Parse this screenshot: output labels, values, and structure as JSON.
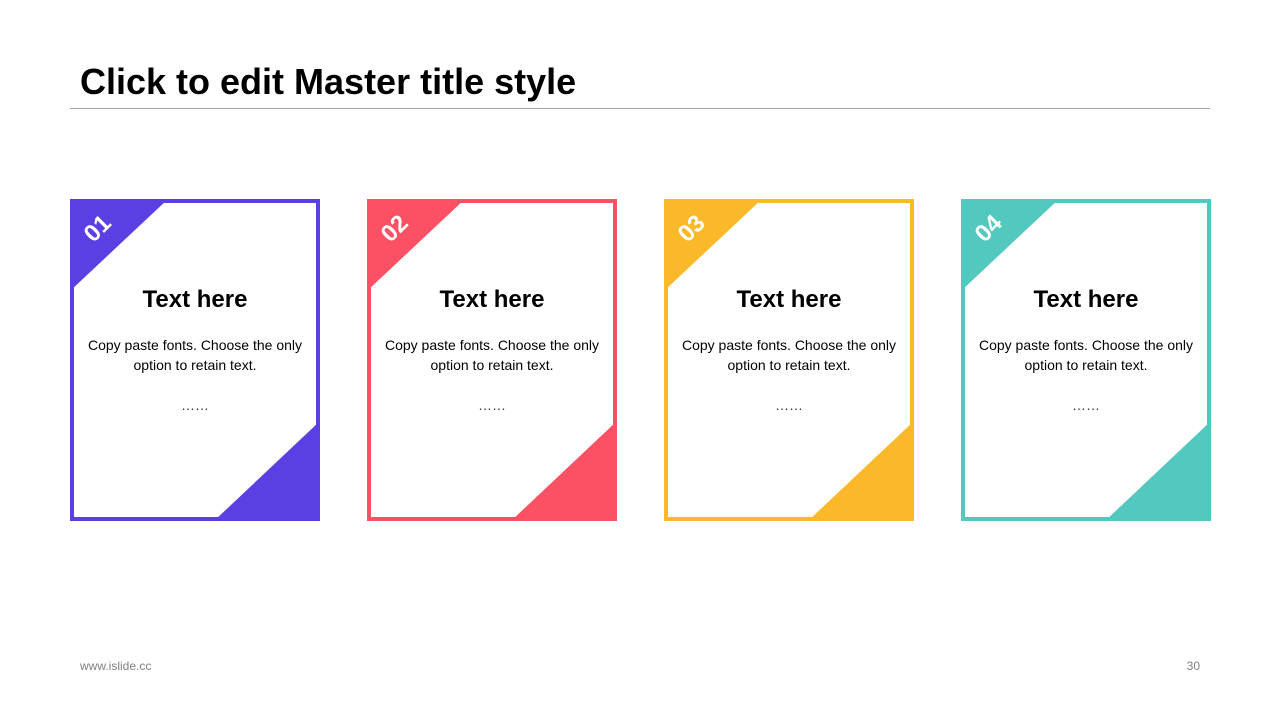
{
  "slide": {
    "title": "Click to edit Master title style",
    "footer_url": "www.islide.cc",
    "page_number": "30"
  },
  "cards": [
    {
      "number": "01",
      "heading": "Text here",
      "body": "Copy paste fonts. Choose the only option to retain text.",
      "dots": "……",
      "color": "#5A3FE2"
    },
    {
      "number": "02",
      "heading": "Text here",
      "body": "Copy paste fonts. Choose the only option to retain text.",
      "dots": "……",
      "color": "#FC5064"
    },
    {
      "number": "03",
      "heading": "Text here",
      "body": "Copy paste fonts. Choose the only option to retain text.",
      "dots": "……",
      "color": "#FBB828"
    },
    {
      "number": "04",
      "heading": "Text here",
      "body": "Copy paste fonts. Choose the only option to retain text.",
      "dots": "……",
      "color": "#53C8BE"
    }
  ]
}
